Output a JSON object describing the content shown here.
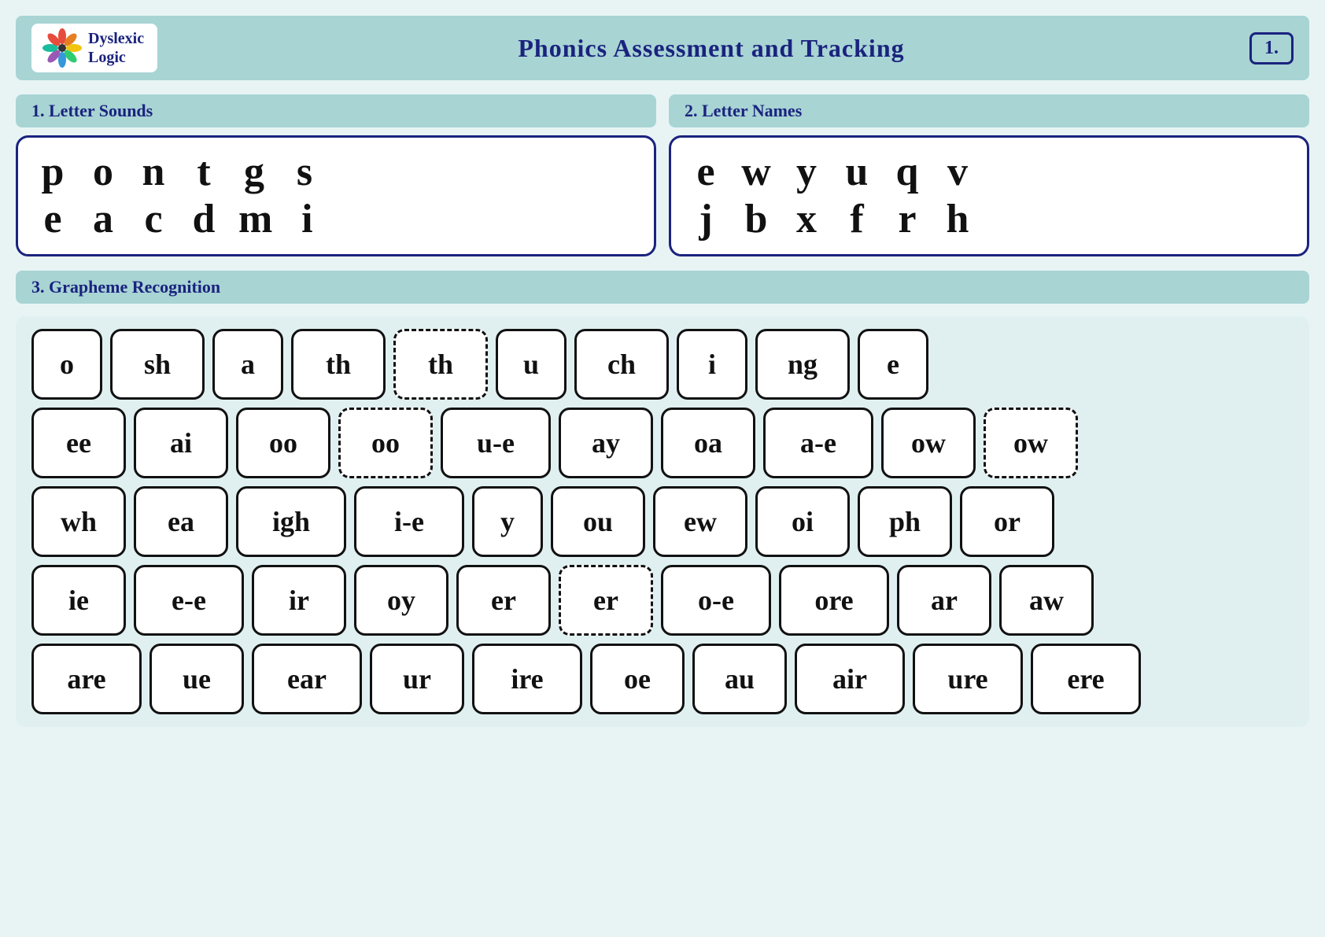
{
  "header": {
    "title": "Phonics Assessment and Tracking",
    "page_num": "1.",
    "logo_line1": "Dyslexic",
    "logo_line2": "Logic"
  },
  "section1": {
    "label": "1. Letter Sounds"
  },
  "section2": {
    "label": "2. Letter Names"
  },
  "section3": {
    "label": "3. Grapheme Recognition"
  },
  "letter_sounds_row1": [
    "p",
    "o",
    "n",
    "t",
    "g",
    "s"
  ],
  "letter_sounds_row2": [
    "e",
    "a",
    "c",
    "d",
    "m",
    "i"
  ],
  "letter_names_row1": [
    "e",
    "w",
    "y",
    "u",
    "q",
    "v"
  ],
  "letter_names_row2": [
    "j",
    "b",
    "x",
    "f",
    "r",
    "h"
  ],
  "graphemes": [
    [
      "o",
      "sh",
      "a",
      "th",
      "th",
      "u",
      "ch",
      "i",
      "ng",
      "e"
    ],
    [
      "ee",
      "ai",
      "oo",
      "oo",
      "u-e",
      "ay",
      "oa",
      "a-e",
      "ow",
      "ow"
    ],
    [
      "wh",
      "ea",
      "igh",
      "i-e",
      "y",
      "ou",
      "ew",
      "oi",
      "ph",
      "or"
    ],
    [
      "ie",
      "e-e",
      "ir",
      "oy",
      "er",
      "er",
      "o-e",
      "ore",
      "ar",
      "aw"
    ],
    [
      "are",
      "ue",
      "ear",
      "ur",
      "ire",
      "oe",
      "au",
      "air",
      "ure",
      "ere"
    ]
  ],
  "grapheme_dashed": {
    "row0": [
      3
    ],
    "row1": [
      2,
      8
    ],
    "row2": [],
    "row3": [
      4
    ],
    "row4": []
  }
}
